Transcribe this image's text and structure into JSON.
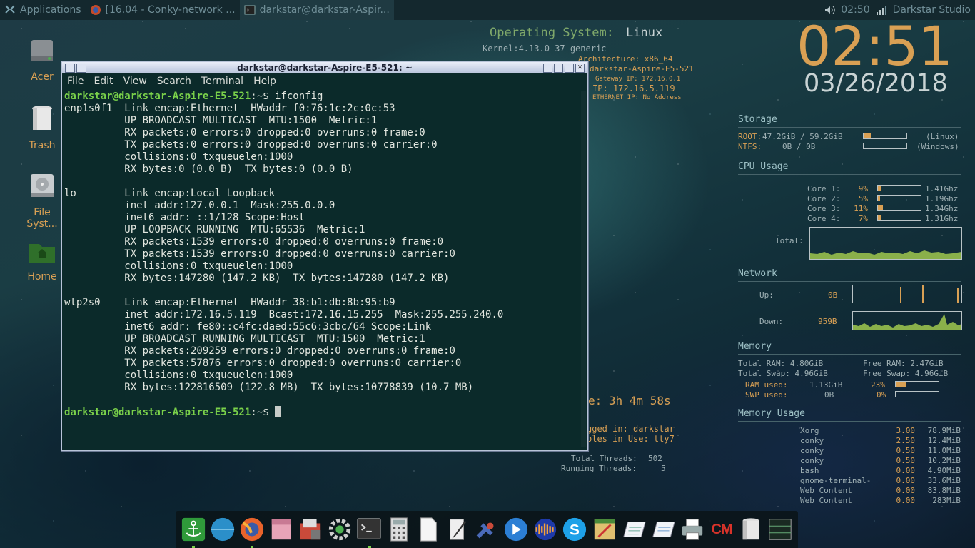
{
  "panel": {
    "tasks": [
      {
        "label": "Applications",
        "icon": "applications-icon"
      },
      {
        "label": "[16.04 - Conky-network ...",
        "icon": "firefox-icon"
      },
      {
        "label": "darkstar@darkstar-Aspir...",
        "icon": "terminal-icon"
      }
    ],
    "clock": "02:50",
    "user": "Darkstar Studio"
  },
  "desktop_icons": [
    {
      "label": "Acer",
      "icon": "drive-icon"
    },
    {
      "label": "Trash",
      "icon": "trash-icon"
    },
    {
      "label": "File Syst...",
      "icon": "filesystem-icon"
    },
    {
      "label": "Home",
      "icon": "home-folder-icon"
    }
  ],
  "terminal": {
    "title": "darkstar@darkstar-Aspire-E5-521: ~",
    "menu": [
      "File",
      "Edit",
      "View",
      "Search",
      "Terminal",
      "Help"
    ],
    "prompt": "darkstar@darkstar-Aspire-E5-521",
    "prompt_suffix": ":~$ ",
    "command": "ifconfig",
    "output": [
      "enp1s0f1  Link encap:Ethernet  HWaddr f0:76:1c:2c:0c:53",
      "          UP BROADCAST MULTICAST  MTU:1500  Metric:1",
      "          RX packets:0 errors:0 dropped:0 overruns:0 frame:0",
      "          TX packets:0 errors:0 dropped:0 overruns:0 carrier:0",
      "          collisions:0 txqueuelen:1000",
      "          RX bytes:0 (0.0 B)  TX bytes:0 (0.0 B)",
      "",
      "lo        Link encap:Local Loopback",
      "          inet addr:127.0.0.1  Mask:255.0.0.0",
      "          inet6 addr: ::1/128 Scope:Host",
      "          UP LOOPBACK RUNNING  MTU:65536  Metric:1",
      "          RX packets:1539 errors:0 dropped:0 overruns:0 frame:0",
      "          TX packets:1539 errors:0 dropped:0 overruns:0 carrier:0",
      "          collisions:0 txqueuelen:1000",
      "          RX bytes:147280 (147.2 KB)  TX bytes:147280 (147.2 KB)",
      "",
      "wlp2s0    Link encap:Ethernet  HWaddr 38:b1:db:8b:95:b9",
      "          inet addr:172.16.5.119  Bcast:172.16.15.255  Mask:255.255.240.0",
      "          inet6 addr: fe80::c4fc:daed:55c6:3cbc/64 Scope:Link",
      "          UP BROADCAST RUNNING MULTICAST  MTU:1500  Metric:1",
      "          RX packets:209259 errors:0 dropped:0 overruns:0 frame:0",
      "          TX packets:57876 errors:0 dropped:0 overruns:0 carrier:0",
      "          collisions:0 txqueuelen:1000",
      "          RX bytes:122816509 (122.8 MB)  TX bytes:10778839 (10.7 MB)",
      ""
    ]
  },
  "conky": {
    "os_label": "Operating System:",
    "os_value": "Linux",
    "kernel": "Kernel:4.13.0-37-generic",
    "arch": "Architecture: x86_64",
    "host": "darkstar-Aspire-E5-521",
    "gateway": "Gateway IP: 172.16.0.1",
    "ip": "IP: 172.16.5.119",
    "ethernet": "ETHERNET IP: No Address",
    "time": "02:51",
    "date": "03/26/2018",
    "uptime": "e: 3h 4m 58s",
    "logged_in": "gged in: darkstar",
    "consoles": "oles in Use: tty7",
    "total_threads_label": "Total Threads:",
    "total_threads": "502",
    "running_threads_label": "Running Threads:",
    "running_threads": "5",
    "storage": {
      "title": "Storage",
      "root_label": "ROOT:",
      "root_value": "47.2GiB / 59.2GiB",
      "root_fill": 0.16,
      "root_tag": "(Linux)",
      "ntfs_label": "NTFS:",
      "ntfs_value": "0B   /    0B",
      "ntfs_fill": 0,
      "ntfs_tag": "(Windows)"
    },
    "cpu": {
      "title": "CPU Usage",
      "cores": [
        {
          "name": "Core 1:",
          "pct": "9%",
          "fill": 0.09,
          "freq": "1.41Ghz"
        },
        {
          "name": "Core 2:",
          "pct": "5%",
          "fill": 0.05,
          "freq": "1.19Ghz"
        },
        {
          "name": "Core 3:",
          "pct": "11%",
          "fill": 0.11,
          "freq": "1.34Ghz"
        },
        {
          "name": "Core 4:",
          "pct": "7%",
          "fill": 0.07,
          "freq": "1.31Ghz"
        }
      ],
      "total_label": "Total:"
    },
    "network": {
      "title": "Network",
      "up_label": "Up:",
      "up_value": "0B",
      "down_label": "Down:",
      "down_value": "959B"
    },
    "memory": {
      "title": "Memory",
      "total_ram": "Total RAM: 4.80GiB",
      "free_ram": "Free RAM: 2.47GiB",
      "total_swap": "Total Swap: 4.96GiB",
      "free_swap": "Free Swap: 4.96GiB",
      "ram_used_label": "RAM used:",
      "ram_used": "1.13GiB",
      "ram_pct": "23%",
      "ram_fill": 0.23,
      "swp_used_label": "SWP used:",
      "swp_used": "0B",
      "swp_pct": "0%",
      "swp_fill": 0
    },
    "memory_usage": {
      "title": "Memory Usage",
      "processes": [
        {
          "name": "Xorg",
          "cpu": "3.00",
          "mem": "78.9MiB"
        },
        {
          "name": "conky",
          "cpu": "2.50",
          "mem": "12.4MiB"
        },
        {
          "name": "conky",
          "cpu": "0.50",
          "mem": "11.0MiB"
        },
        {
          "name": "conky",
          "cpu": "0.50",
          "mem": "10.2MiB"
        },
        {
          "name": "bash",
          "cpu": "0.00",
          "mem": "4.90MiB"
        },
        {
          "name": "gnome-terminal-",
          "cpu": "0.00",
          "mem": "33.6MiB"
        },
        {
          "name": "Web Content",
          "cpu": "0.00",
          "mem": "83.8MiB"
        },
        {
          "name": "Web Content",
          "cpu": "0.00",
          "mem": "283MiB"
        }
      ]
    }
  },
  "dock": {
    "items": [
      {
        "icon": "anchor-icon"
      },
      {
        "icon": "browser-globe-icon"
      },
      {
        "icon": "firefox-icon"
      },
      {
        "icon": "file-manager-icon"
      },
      {
        "icon": "package-manager-icon"
      },
      {
        "icon": "settings-gear-icon"
      },
      {
        "icon": "terminal-icon"
      },
      {
        "icon": "calculator-icon"
      },
      {
        "icon": "document-icon"
      },
      {
        "icon": "text-editor-icon"
      },
      {
        "icon": "satellite-icon"
      },
      {
        "icon": "media-player-icon"
      },
      {
        "icon": "audio-editor-icon"
      },
      {
        "icon": "skype-icon"
      },
      {
        "icon": "image-editor-icon"
      },
      {
        "icon": "notepad-icon"
      },
      {
        "icon": "notes-icon"
      },
      {
        "icon": "printer-icon"
      },
      {
        "icon": "cm-app-icon",
        "label": "CM"
      },
      {
        "icon": "trash-icon"
      },
      {
        "icon": "workspace-switcher-icon"
      }
    ]
  }
}
